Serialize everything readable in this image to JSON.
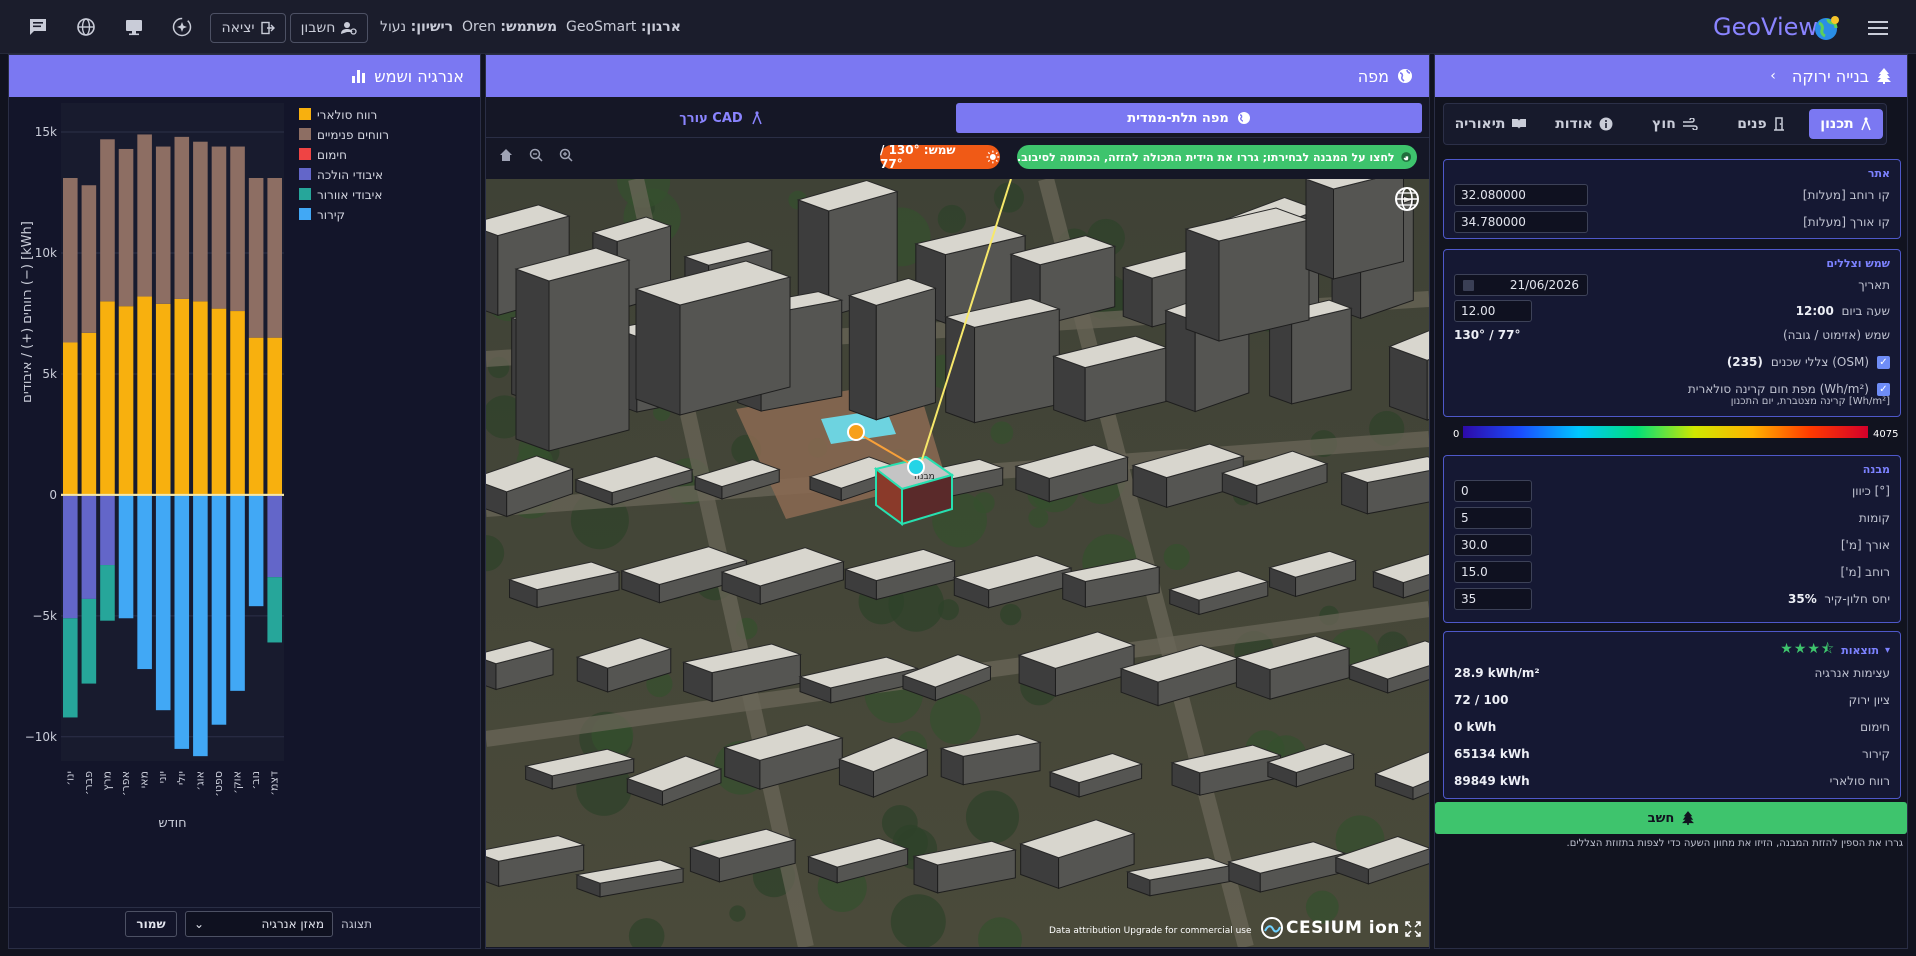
{
  "topbar": {
    "brand": "GeoView",
    "org_label": "ארגון:",
    "org_value": "GeoSmart",
    "user_label": "משתמש:",
    "user_value": "Oren",
    "license_label": "רישיון:",
    "license_value": "נעול",
    "account_button": "חשבון",
    "logout_button": "יציאה"
  },
  "right_panel": {
    "title": "בנייה ירוקה",
    "tabs": [
      "תכנון",
      "פנים",
      "חוץ",
      "אודות",
      "תיאוריה"
    ],
    "site": {
      "title": "אתר",
      "lat_label": "קו רוחב [מעלות]",
      "lat_value": "32.080000",
      "lon_label": "קו אורך [מעלות]",
      "lon_value": "34.780000"
    },
    "sun": {
      "title": "שמש וצללים",
      "date_label": "תאריך",
      "date_value": "21/06/2026",
      "time_label": "שעה ביום",
      "time_display": "12:00",
      "time_value": "12.00",
      "sunpos_label": "שמש (אזימוט / גובה)",
      "sunpos_value": "130° / 77°",
      "shadow_label": "צללי שכנים (OSM)",
      "shadow_count": "(235)",
      "heatmap_label": "מפת חום קרינה סולארית (Wh/m²)",
      "scale_label": "קרינה מצטברת, יום התכנון [Wh/m²]",
      "scale_min": "0",
      "scale_max": "4075"
    },
    "building": {
      "title": "מבנה",
      "orient_label": "כיוון [°]",
      "orient_value": "0",
      "floors_label": "קומות",
      "floors_value": "5",
      "length_label": "אורך [מ']",
      "length_value": "30.0",
      "width_label": "רוחב [מ']",
      "width_value": "15.0",
      "wwr_label": "יחס חלון-קיר",
      "wwr_value": "35",
      "wwr_display": "35%"
    },
    "results": {
      "title": "תוצאות",
      "rating_stars": 3.5,
      "items": [
        {
          "label": "עצימות אנרגיה",
          "value": "28.9 kWh/m²"
        },
        {
          "label": "ציון ירוק",
          "value": "72 / 100"
        },
        {
          "label": "חימום",
          "value": "0 kWh"
        },
        {
          "label": "קירור",
          "value": "65134 kWh"
        },
        {
          "label": "רווח סולארי",
          "value": "89849 kWh"
        }
      ]
    },
    "calc_button": "חשב",
    "hint": "גררו את הספין להזזת המבנה, הזיזו את מחוון השעה כדי לצפות בתזוזת הצללים."
  },
  "map_panel": {
    "title": "מפה",
    "tab_3d": "מפה תלת-ממדית",
    "tab_cad": "עורך CAD",
    "info_banner": "לחצו על המבנה לבחירתו; גררו את הידית התכולה להזזה, הכתומה לסיבוב.",
    "sun_badge": "שמש: 130° / 77°",
    "building_label": "מבנה",
    "attribution": "Data attribution   Upgrade for commercial use",
    "cesium_logo": "CESIUM ion"
  },
  "energy_panel": {
    "title": "אנרגיה ושמש",
    "display_label": "תצוגה",
    "display_value": "מאזן אנרגיה",
    "save_button": "שמור"
  },
  "chart_data": {
    "type": "bar",
    "stacked": true,
    "categories": [
      "ינו׳",
      "פבר׳",
      "מרץ",
      "אפר׳",
      "מאי",
      "יוני",
      "יולי",
      "אוג׳",
      "ספט׳",
      "אוק׳",
      "נוב׳",
      "דצמ׳"
    ],
    "xlabel": "חודש",
    "ylabel": "רווחים (+) / איבודים (−) [kWh]",
    "ylim": [
      -11000,
      16200
    ],
    "yticks": [
      -10000,
      -5000,
      0,
      5000,
      10000,
      15000
    ],
    "ytick_labels": [
      "−10k",
      "−5k",
      "0",
      "5k",
      "10k",
      "15k"
    ],
    "grid": true,
    "legend_position": "top-right",
    "series": [
      {
        "name": "רווח סולארי",
        "color": "#f8b00e",
        "values": [
          6300,
          6700,
          8000,
          7800,
          8200,
          7900,
          8100,
          8000,
          7700,
          6500,
          null,
          null
        ],
        "values_full": [
          6300,
          6700,
          8000,
          7800,
          8200,
          7900,
          8100,
          8000,
          7700,
          6500,
          0,
          0
        ]
      },
      {
        "name": "רווחים פנימיים",
        "color": "#8d6e63",
        "values_full": [
          6800,
          6100,
          6700,
          6500,
          6700,
          6500,
          6700,
          6600,
          6700,
          6600,
          0,
          0
        ]
      },
      {
        "name": "חימום",
        "color": "#ef4444",
        "values_full": [
          0,
          0,
          0,
          0,
          0,
          0,
          0,
          0,
          0,
          0,
          0,
          0
        ]
      },
      {
        "name": "איבודי הולכה",
        "color": "#6366c9",
        "values_full": [
          -5100,
          -4300,
          -2900,
          0,
          0,
          0,
          0,
          0,
          0,
          0,
          0,
          0
        ]
      },
      {
        "name": "איבודי אוורור",
        "color": "#26a69a",
        "values_full": [
          -4100,
          -3500,
          -2300,
          0,
          0,
          0,
          0,
          0,
          0,
          0,
          0,
          0
        ]
      },
      {
        "name": "קירור",
        "color": "#41a8f5",
        "values_full": [
          0,
          0,
          0,
          -5100,
          -7200,
          -8900,
          -10500,
          -10800,
          -9500,
          -8100,
          0,
          0
        ]
      }
    ],
    "bars_visible": 12,
    "bar_values": [
      {
        "pos": [
          6300,
          6800
        ],
        "neg": [
          0,
          -5100,
          -4100,
          0
        ]
      },
      {
        "pos": [
          6700,
          6100
        ],
        "neg": [
          0,
          -4300,
          -3500,
          0
        ]
      },
      {
        "pos": [
          8000,
          6700
        ],
        "neg": [
          0,
          -2900,
          -2300,
          0
        ]
      },
      {
        "pos": [
          7800,
          6500
        ],
        "neg": [
          0,
          0,
          0,
          -5100
        ]
      },
      {
        "pos": [
          8200,
          6700
        ],
        "neg": [
          0,
          0,
          0,
          -7200
        ]
      },
      {
        "pos": [
          7900,
          6500
        ],
        "neg": [
          0,
          0,
          0,
          -8900
        ]
      },
      {
        "pos": [
          8100,
          6700
        ],
        "neg": [
          0,
          0,
          0,
          -10500
        ]
      },
      {
        "pos": [
          8000,
          6600
        ],
        "neg": [
          0,
          0,
          0,
          -10800
        ]
      },
      {
        "pos": [
          7700,
          6700
        ],
        "neg": [
          0,
          0,
          0,
          -9500
        ]
      },
      {
        "pos": [
          7600,
          6800
        ],
        "neg": [
          0,
          0,
          0,
          -8100
        ]
      },
      {
        "pos": [
          6500,
          6600
        ],
        "neg": [
          0,
          0,
          0,
          -4600
        ]
      },
      {
        "pos": [
          6500,
          6600
        ],
        "neg": [
          0,
          -3400,
          -2700,
          0
        ]
      }
    ]
  },
  "colors": {
    "accent": "#7b78f2",
    "success": "#3ec46d",
    "warning": "#f05a16",
    "bg": "#11131f"
  }
}
